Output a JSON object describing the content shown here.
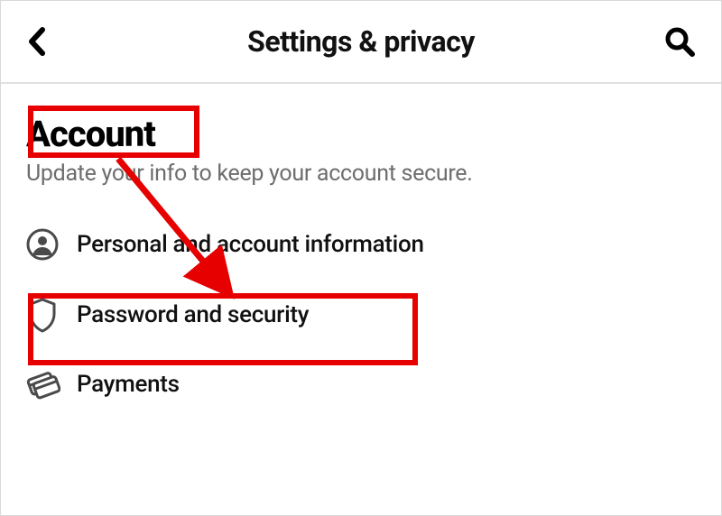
{
  "header": {
    "title": "Settings & privacy"
  },
  "section": {
    "heading": "Account",
    "subtitle": "Update your info to keep your account secure."
  },
  "rows": {
    "personal": "Personal and account information",
    "password": "Password and security",
    "payments": "Payments"
  }
}
